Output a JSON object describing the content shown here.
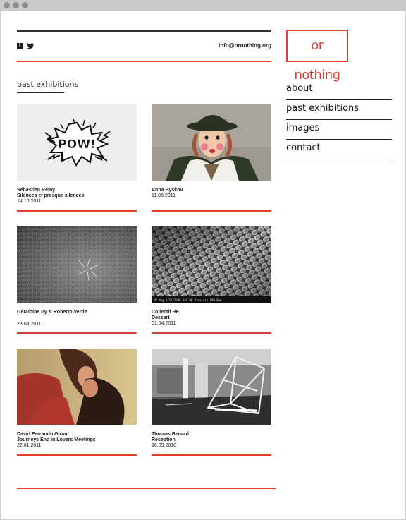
{
  "header": {
    "email": "info@ornothing.org",
    "logo": "or nothing",
    "social": {
      "facebook_glyph": "f"
    }
  },
  "nav": {
    "items": [
      {
        "label": "about"
      },
      {
        "label": "past exhibitions"
      },
      {
        "label": "images"
      },
      {
        "label": "contact"
      }
    ]
  },
  "section": {
    "title": "past exhibitions"
  },
  "exhibitions": [
    {
      "artist": "Sébastien Rémy",
      "title": "Silences et presque silences",
      "date": "14.10.2011",
      "thumb_text": "POW!"
    },
    {
      "artist": "Anna Byskov",
      "title": "",
      "date": "11.06.2011"
    },
    {
      "artist": "Géraldine Py & Roberto Verde",
      "title": "",
      "date": "23.04.2011"
    },
    {
      "artist": "Collectif RE:",
      "title": "Dessert",
      "date": "01.04.2011",
      "thumb_caption": "HV   Mag   1/11/2008   Det   WD   Pressure   100.0μm"
    },
    {
      "artist": "David Ferrando Giraut",
      "title": "Journeys End in Lovers Meetings",
      "date": "22.01.2011"
    },
    {
      "artist": "Thomas Benard",
      "title": "Reception",
      "date": "16.09.2010"
    }
  ]
}
